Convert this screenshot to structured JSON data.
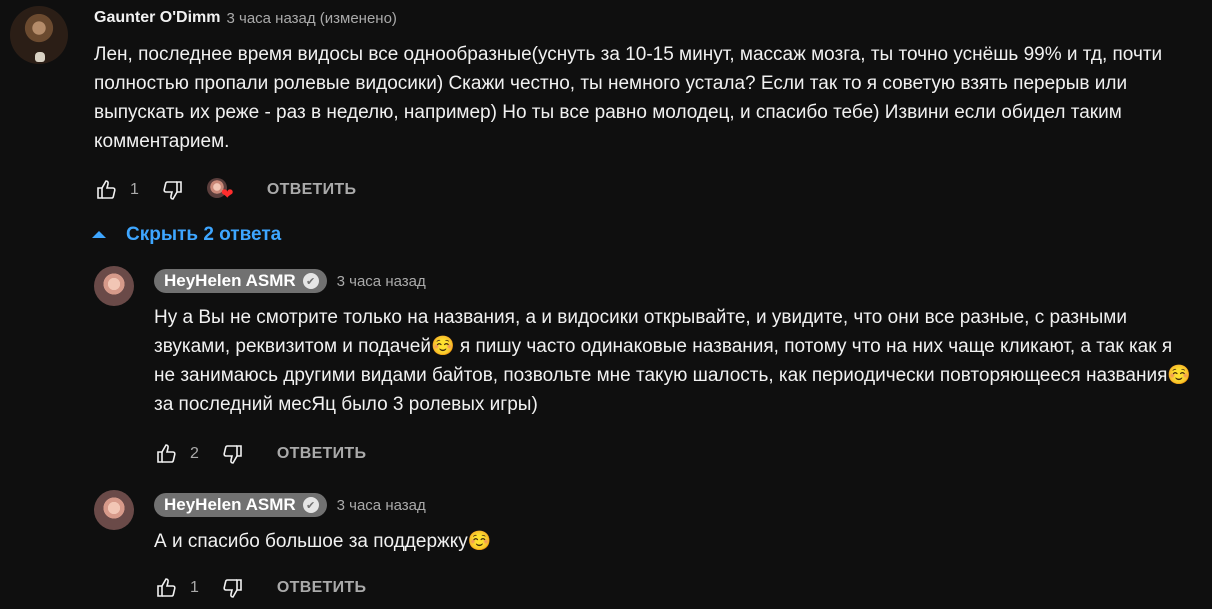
{
  "main_comment": {
    "author": "Gaunter O'Dimm",
    "time": "3 часа назад (изменено)",
    "text": "Лен, последнее время видосы все однообразные(уснуть за 10-15 минут, массаж мозга, ты точно уснёшь 99% и тд, почти полностью пропали ролевые видосики) Скажи честно, ты немного устала? Если так то я советую взять перерыв или выпускать их реже - раз в неделю, например) Но ты все равно молодец, и спасибо тебе) Извини если обидел таким комментарием.",
    "likes": "1",
    "reply_label": "ОТВЕТИТЬ"
  },
  "toggle": {
    "label": "Скрыть 2 ответа"
  },
  "replies": [
    {
      "author": "HeyHelen ASMR",
      "time": "3 часа назад",
      "text": "Ну а Вы не смотрите только на названия, а и видосики открывайте, и увидите, что они все разные, с разными звуками, реквизитом и подачей☺️ я пишу часто одинаковые названия, потому что на них чаще кликают, а так как я не занимаюсь другими видами байтов, позвольте мне такую шалость, как периодически повторяющееся названия☺️ за последний месЯц было 3 ролевых игры)",
      "likes": "2",
      "reply_label": "ОТВЕТИТЬ"
    },
    {
      "author": "HeyHelen ASMR",
      "time": "3 часа назад",
      "text": "А и спасибо большое за поддержку☺️",
      "likes": "1",
      "reply_label": "ОТВЕТИТЬ"
    }
  ],
  "icons": {
    "like": "thumbs-up-icon",
    "dislike": "thumbs-down-icon",
    "heart": "heart-icon",
    "verified": "check-circle-icon",
    "caret": "caret-up-icon"
  },
  "colors": {
    "background": "#0f0f0f",
    "text": "#f1f1f1",
    "muted": "#aaaaaa",
    "link": "#3ea6ff",
    "heart": "#ff2d2d"
  }
}
